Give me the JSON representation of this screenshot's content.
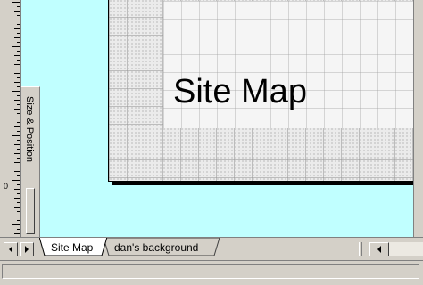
{
  "drawing": {
    "title": "Site Map",
    "background_color": "#c0ffff",
    "page_color": "#ebebeb"
  },
  "ruler": {
    "zero_label": "0"
  },
  "dock_panel": {
    "title": "Size & Position"
  },
  "tabs": [
    {
      "label": "Site Map",
      "active": true
    },
    {
      "label": "dan's background",
      "active": false
    }
  ],
  "icons": {
    "tab_prev": "left-arrow-icon",
    "tab_next": "right-arrow-icon",
    "hscroll_left": "left-arrow-icon"
  }
}
